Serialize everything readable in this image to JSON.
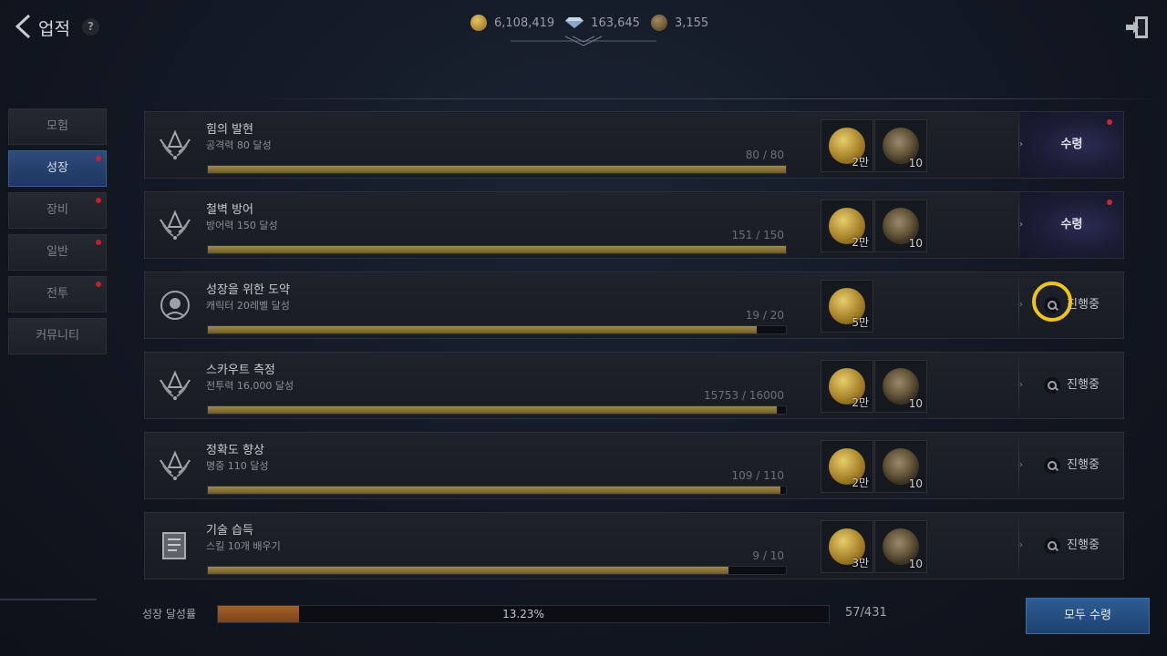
{
  "header": {
    "title": "업적",
    "help": "?",
    "currencies": [
      {
        "icon": "gold-coin-icon",
        "value": "6,108,419"
      },
      {
        "icon": "diamond-icon",
        "value": "163,645"
      },
      {
        "icon": "bronze-coin-icon",
        "value": "3,155"
      }
    ]
  },
  "sidebar": {
    "items": [
      {
        "label": "모험",
        "active": false,
        "dot": false
      },
      {
        "label": "성장",
        "active": true,
        "dot": true
      },
      {
        "label": "장비",
        "active": false,
        "dot": true
      },
      {
        "label": "일반",
        "active": false,
        "dot": true
      },
      {
        "label": "전투",
        "active": false,
        "dot": true
      },
      {
        "label": "커뮤니티",
        "active": false,
        "dot": false
      }
    ]
  },
  "achievements": [
    {
      "name": "힘의 발현",
      "desc": "공격력 80 달성",
      "count": "80 / 80",
      "progress": 1.0,
      "rewards": [
        {
          "type": "gold",
          "amount": "2만"
        },
        {
          "type": "bronze",
          "amount": "10"
        }
      ],
      "action": "수령",
      "state": "claim"
    },
    {
      "name": "철벽 방어",
      "desc": "방어력 150 달성",
      "count": "151 / 150",
      "progress": 1.0,
      "rewards": [
        {
          "type": "gold",
          "amount": "2만"
        },
        {
          "type": "bronze",
          "amount": "10"
        }
      ],
      "action": "수령",
      "state": "claim"
    },
    {
      "name": "성장을 위한 도약",
      "desc": "캐릭터 20레벨 달성",
      "count": "19 / 20",
      "progress": 0.95,
      "rewards": [
        {
          "type": "gold",
          "amount": "5만"
        }
      ],
      "action": "진행중",
      "state": "progress"
    },
    {
      "name": "스카우트 측정",
      "desc": "전투력 16,000 달성",
      "count": "15753 / 16000",
      "progress": 0.985,
      "rewards": [
        {
          "type": "gold",
          "amount": "2만"
        },
        {
          "type": "bronze",
          "amount": "10"
        }
      ],
      "action": "진행중",
      "state": "progress"
    },
    {
      "name": "정확도 향상",
      "desc": "명중 110 달성",
      "count": "109 / 110",
      "progress": 0.99,
      "rewards": [
        {
          "type": "gold",
          "amount": "2만"
        },
        {
          "type": "bronze",
          "amount": "10"
        }
      ],
      "action": "진행중",
      "state": "progress"
    },
    {
      "name": "기술 습득",
      "desc": "스킬 10개 배우기",
      "count": "9 / 10",
      "progress": 0.9,
      "rewards": [
        {
          "type": "gold",
          "amount": "3만"
        },
        {
          "type": "bronze",
          "amount": "10"
        }
      ],
      "action": "진행중",
      "state": "progress"
    }
  ],
  "footer": {
    "label": "성장 달성률",
    "percent_text": "13.23%",
    "progress": 0.1323,
    "count": "57/431",
    "claim_all": "모두 수령"
  }
}
